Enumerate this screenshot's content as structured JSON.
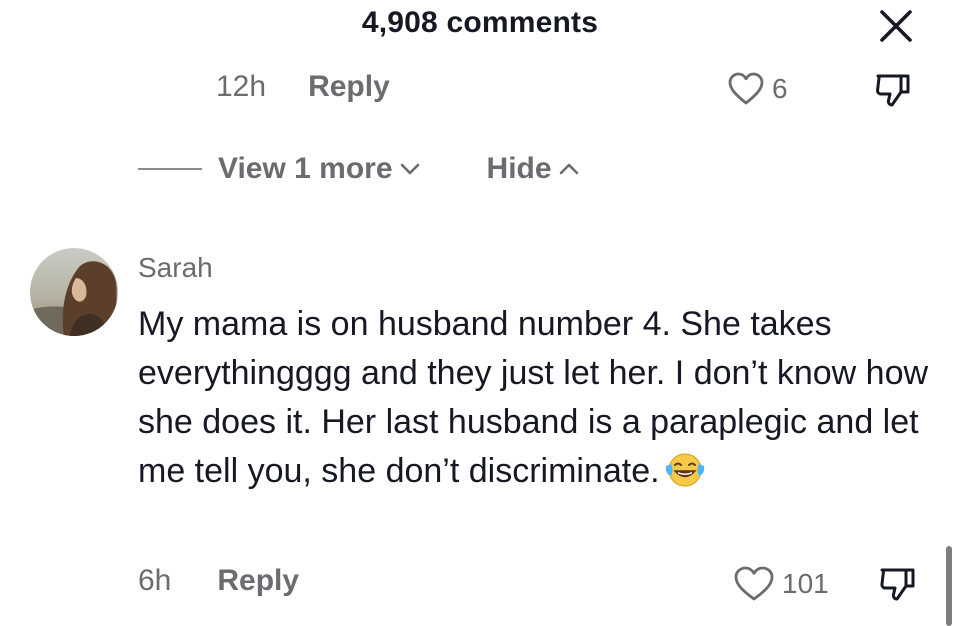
{
  "header": {
    "title": "4,908 comments"
  },
  "previous_reply": {
    "time": "12h",
    "reply_label": "Reply",
    "like_count": "6"
  },
  "thread": {
    "view_more_label": "View 1 more",
    "hide_label": "Hide"
  },
  "comment": {
    "username": "Sarah",
    "text": "My mama is on husband number 4. She takes everythingggg and they just let her. I don’t know how she does it. Her last husband is a paraplegic and let me tell you, she don’t discriminate.",
    "emoji": "face-with-tears-of-joy",
    "time": "6h",
    "reply_label": "Reply",
    "like_count": "101"
  },
  "colors": {
    "text_primary": "#161823",
    "text_secondary": "#6b6b70",
    "background": "#ffffff"
  }
}
